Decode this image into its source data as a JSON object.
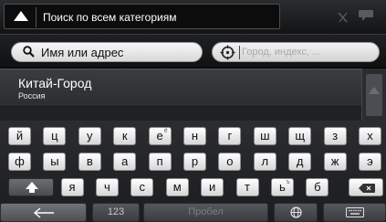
{
  "header": {
    "title": "Поиск по всем категориям"
  },
  "search": {
    "name_field_value": "Имя или адрес",
    "city_field_placeholder": "Город, индекс, ..."
  },
  "results": [
    {
      "name": "Китай-Город",
      "country": "Россия"
    }
  ],
  "keyboard": {
    "row1": [
      {
        "k": "й"
      },
      {
        "k": "ц"
      },
      {
        "k": "у"
      },
      {
        "k": "к"
      },
      {
        "k": "е",
        "sup": "ё"
      },
      {
        "k": "н"
      },
      {
        "k": "г"
      },
      {
        "k": "ш"
      },
      {
        "k": "щ"
      },
      {
        "k": "з"
      },
      {
        "k": "х"
      }
    ],
    "row2": [
      {
        "k": "ф"
      },
      {
        "k": "ы"
      },
      {
        "k": "в"
      },
      {
        "k": "а"
      },
      {
        "k": "п"
      },
      {
        "k": "р"
      },
      {
        "k": "о"
      },
      {
        "k": "л"
      },
      {
        "k": "д"
      },
      {
        "k": "ж"
      },
      {
        "k": "э"
      }
    ],
    "row3": [
      {
        "k": "я"
      },
      {
        "k": "ч"
      },
      {
        "k": "с"
      },
      {
        "k": "м"
      },
      {
        "k": "и"
      },
      {
        "k": "т"
      },
      {
        "k": "ь",
        "sup": "ъ"
      },
      {
        "k": "б"
      }
    ],
    "numbers_label": "123",
    "space_label": "Пробел"
  },
  "icons": {
    "up": "up-arrow-icon",
    "signal": "signal-icon",
    "chat": "chat-icon",
    "search": "search-icon",
    "target": "crosshair-icon",
    "shift": "shift-icon",
    "backspace": "backspace-icon",
    "back": "back-arrow-icon",
    "globe": "globe-icon",
    "keyboard": "keyboard-icon"
  }
}
